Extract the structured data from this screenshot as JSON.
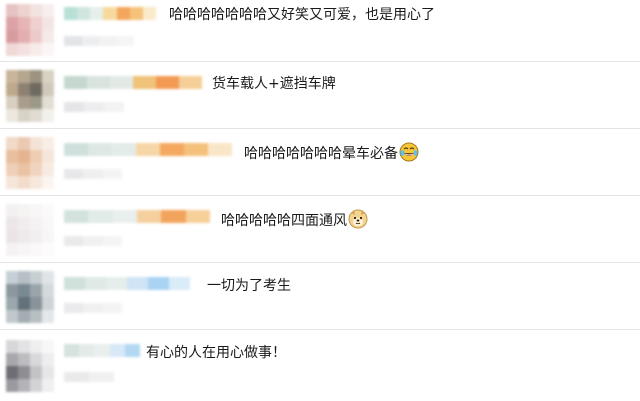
{
  "comments": [
    {
      "text": "哈哈哈哈哈哈哈又好笑又可爱，也是用心了",
      "colors": {
        "avatar": [
          "#e6c3c3",
          "#edd3d0",
          "#f2e2e0",
          "#f7eeee",
          "#dca3a6",
          "#e7b5b6",
          "#f0cfcf",
          "#f4e5e5",
          "#d79c9f",
          "#e3aeb0",
          "#edcaca",
          "#f6e9e9",
          "#efd8d6",
          "#f3e1df",
          "#f7ecea",
          "#fbf5f5"
        ],
        "username": [
          "#b8e0d7",
          "#cfe6de",
          "#e6efe9",
          "#f7d99e",
          "#f3a65c",
          "#f6c27a",
          "#faeac9"
        ],
        "sub": [
          "#d9dbe0",
          "#e6e7ea",
          "#eeeeee",
          "#f2f2f2"
        ]
      }
    },
    {
      "text": "货车载人+遮挡车牌",
      "colors": {
        "avatar": [
          "#c9b59a",
          "#b5a68f",
          "#9b937f",
          "#d8d2c3",
          "#bfa98c",
          "#8d8173",
          "#6f6a60",
          "#d0c9bb",
          "#d8cfc0",
          "#a99d8c",
          "#9c9889",
          "#e3ded3",
          "#ece8e0",
          "#d9d3c7",
          "#e0dcd2",
          "#f2f0ea"
        ],
        "username": [
          "#c5d8cf",
          "#d9e4de",
          "#e2eae6",
          "#f0c27a",
          "#f29a54",
          "#f6cf98"
        ],
        "sub": [
          "#dcdde0",
          "#e8e8ea",
          "#efefef"
        ]
      }
    },
    {
      "text": "哈哈哈哈哈哈哈晕车必备",
      "emoji": "crying-laughing-emoji",
      "colors": {
        "avatar": [
          "#f1dac8",
          "#ecc9b1",
          "#f4e3d6",
          "#f8eee6",
          "#e8bf9f",
          "#e5b48f",
          "#eecdb3",
          "#f5e6da",
          "#efcfb8",
          "#eac2a4",
          "#f0d4bf",
          "#f7ebe1",
          "#f6e6da",
          "#f3dccb",
          "#f6e8dd",
          "#fbf4ef"
        ],
        "username": [
          "#cfe0dc",
          "#dde8e4",
          "#e3ece8",
          "#f6d6a6",
          "#f5a85f",
          "#f5c07c",
          "#f9e6c6"
        ],
        "sub": [
          "#e0e0e2",
          "#eaeaea",
          "#f0f0f0"
        ]
      }
    },
    {
      "text": "哈哈哈哈哈四面通风",
      "emoji": "doge-emoji",
      "colors": {
        "avatar": [
          "#f3f0f0",
          "#f6f3f3",
          "#f8f6f6",
          "#fbfafa",
          "#ece6e8",
          "#f1edee",
          "#f5f2f3",
          "#f9f7f8",
          "#ebe4e7",
          "#eee9eb",
          "#f3eff1",
          "#f8f6f7",
          "#f5f2f3",
          "#f7f5f6",
          "#faf8f9",
          "#fcfbfc"
        ],
        "username": [
          "#d3e2dd",
          "#e1ebe7",
          "#e9efed",
          "#f5cf9e",
          "#f3a45c",
          "#f7cf99"
        ],
        "sub": [
          "#e3e3e5",
          "#ececec",
          "#f1f1f1"
        ]
      }
    },
    {
      "text": "一切为了考生",
      "colors": {
        "avatar": [
          "#c5d0d6",
          "#b5bfc4",
          "#c7cfd2",
          "#e0e4e6",
          "#8b979d",
          "#7a8a92",
          "#9aa5aa",
          "#d4dadc",
          "#9aa8ad",
          "#63717a",
          "#889399",
          "#cdd3d6",
          "#c0c8cc",
          "#a3adb2",
          "#b7bfc3",
          "#e3e7e9"
        ],
        "username": [
          "#d0e1dc",
          "#dfe9e5",
          "#e6eeeb",
          "#cfe4f5",
          "#a9d3f2",
          "#d9ecf8"
        ],
        "sub": [
          "#e2e3e5",
          "#ebebeb",
          "#f0f0f0"
        ]
      }
    },
    {
      "text": "有心的人在用心做事！",
      "colors": {
        "avatar": [
          "#d7d7d9",
          "#e3e3e5",
          "#eeeeef",
          "#f7f7f8",
          "#a8a8ac",
          "#bdbdc1",
          "#d9d9db",
          "#eeeeef",
          "#6d6d74",
          "#8d8d93",
          "#c3c3c7",
          "#e6e6e8",
          "#9a9aa0",
          "#b3b3b8",
          "#d3d3d6",
          "#efeff0"
        ],
        "username": [
          "#d5e2de",
          "#e3ebe8",
          "#e9efed",
          "#d7e8f6",
          "#b2d8f3"
        ],
        "sub": [
          "#e3e3e5",
          "#ececec"
        ]
      }
    }
  ]
}
